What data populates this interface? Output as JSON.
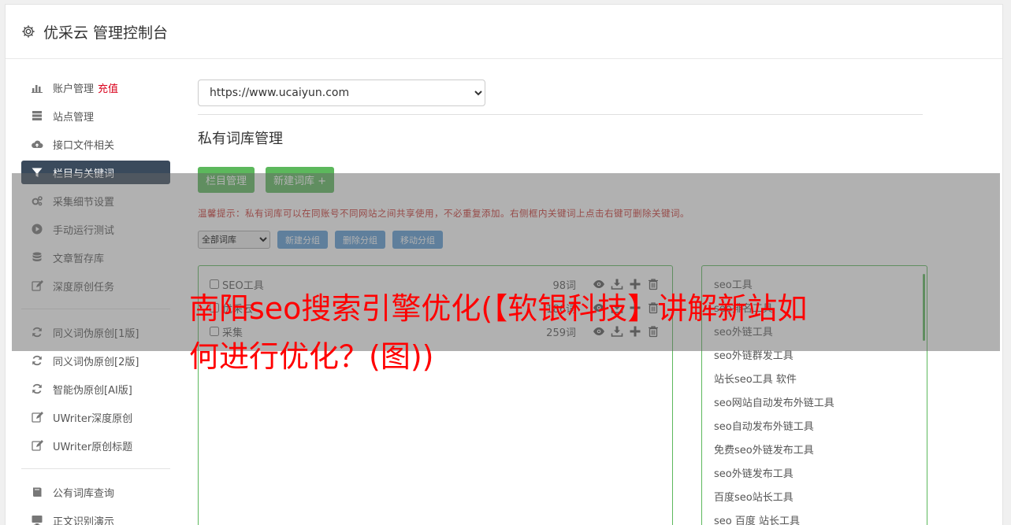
{
  "header": {
    "title": "优采云 管理控制台",
    "icon": "gear-icon"
  },
  "sidebar": {
    "groups": [
      [
        {
          "label": "账户管理",
          "badge": "充值",
          "icon": "bar-chart-icon",
          "active": false
        },
        {
          "label": "站点管理",
          "icon": "server-icon",
          "active": false
        },
        {
          "label": "接口文件相关",
          "icon": "cloud-upload-icon",
          "active": false
        },
        {
          "label": "栏目与关键词",
          "icon": "filter-icon",
          "active": true
        },
        {
          "label": "采集细节设置",
          "icon": "gears-icon",
          "active": false
        },
        {
          "label": "手动运行测试",
          "icon": "play-circle-icon",
          "active": false
        },
        {
          "label": "文章暂存库",
          "icon": "database-icon",
          "active": false
        },
        {
          "label": "深度原创任务",
          "icon": "edit-icon",
          "active": false
        }
      ],
      [
        {
          "label": "同义词伪原创[1版]",
          "icon": "refresh-icon",
          "active": false
        },
        {
          "label": "同义词伪原创[2版]",
          "icon": "refresh-icon",
          "active": false
        },
        {
          "label": "智能伪原创[AI版]",
          "icon": "refresh-icon",
          "active": false
        },
        {
          "label": "UWriter深度原创",
          "icon": "edit-icon",
          "active": false
        },
        {
          "label": "UWriter原创标题",
          "icon": "edit-icon",
          "active": false
        }
      ],
      [
        {
          "label": "公有词库查询",
          "icon": "book-icon",
          "active": false
        },
        {
          "label": "正文识别演示",
          "icon": "monitor-icon",
          "active": false
        }
      ]
    ]
  },
  "main": {
    "site_select": "https://www.ucaiyun.com",
    "section_title": "私有词库管理",
    "btn_column": "栏目管理",
    "btn_new_lib": "新建词库 +",
    "hint": "温馨提示：私有词库可以在同账号不同网站之间共享使用，不必重复添加。右侧框内关键词上点击右键可删除关键词。",
    "group_select": "全部词库",
    "btn_new_group": "新建分组",
    "btn_del_group": "删除分组",
    "btn_move_group": "移动分组",
    "libraries": [
      {
        "name": "SEO工具",
        "count": "98词"
      },
      {
        "name": "优采云",
        "count": "186词"
      },
      {
        "name": "采集",
        "count": "259词"
      }
    ],
    "keywords": [
      "seo工具",
      "seo排名工具",
      "seo外链工具",
      "seo外链群发工具",
      "站长seo工具 软件",
      "seo网站自动发布外链工具",
      "seo自动发布外链工具",
      "免费seo外链发布工具",
      "seo外链发布工具",
      "百度seo站长工具",
      "seo 百度 站长工具"
    ]
  },
  "ad_title": "南阳seo搜索引擎优化(【软银科技】讲解新站如何进行优化？(图))",
  "colors": {
    "active_nav": "#3a4a5c",
    "green": "#5cb85c",
    "blue": "#5b9bd5",
    "hint_red": "#c9302c",
    "ad_red": "#ff0000"
  }
}
